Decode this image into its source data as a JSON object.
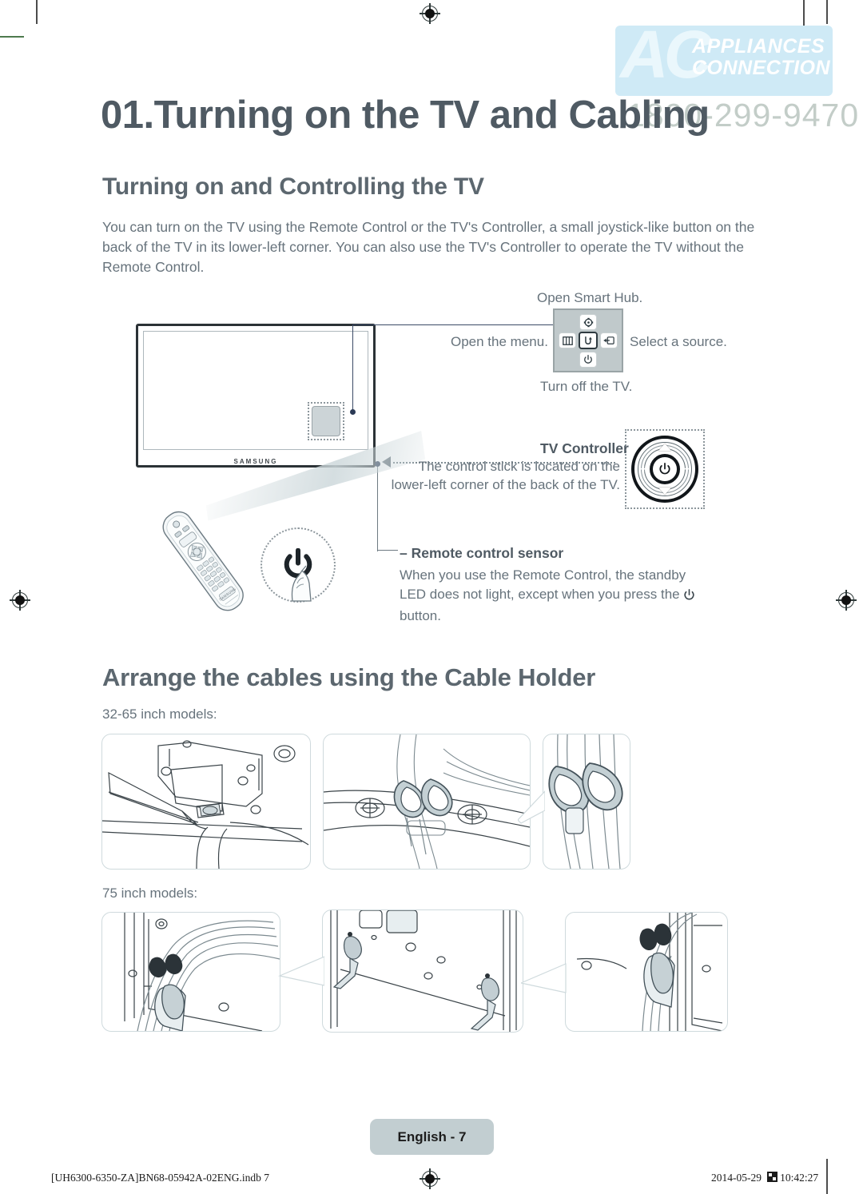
{
  "document": {
    "chapter_title": "01.Turning on the TV and Cabling",
    "page_badge": "English - 7",
    "footer_left": "[UH6300-6350-ZA]BN68-05942A-02ENG.indb   7",
    "footer_date": "2014-05-29",
    "footer_time": "10:42:27"
  },
  "watermark": {
    "logo_mark": "AC",
    "line1": "APPLIANCES",
    "line2": "CONNECTION",
    "phone": "1800-299-9470",
    "bg_color": "#cfeaf6"
  },
  "section_control": {
    "heading": "Turning on and Controlling the TV",
    "paragraph": "You can turn on the TV using the Remote Control or the TV's Controller, a small joystick-like button on the back of the TV in its lower-left corner. You can also use the TV's Controller to operate the TV without the Remote Control."
  },
  "controller_diagram": {
    "label_smart_hub": "Open Smart Hub.",
    "label_menu": "Open the menu.",
    "label_source": "Select a source.",
    "label_power": "Turn off the TV.",
    "keys": {
      "up_icon": "smart-hub-icon",
      "up_glyph": "⚙",
      "left_icon": "menu-icon",
      "left_glyph": "☰",
      "center_icon": "return-icon",
      "center_glyph": "↺",
      "right_icon": "source-icon",
      "right_glyph": "↤",
      "down_icon": "power-icon",
      "down_glyph": "⏻"
    }
  },
  "tv_illustration": {
    "brand": "SAMSUNG"
  },
  "tv_controller": {
    "title": "TV Controller",
    "description": "The control stick is located on the lower-left corner of the back of the TV.",
    "joystick": {
      "center_glyph": "⏻",
      "plus": "+",
      "minus": "−"
    }
  },
  "remote_sensor": {
    "title": "Remote control sensor",
    "description_before": "When you use the Remote Control, the standby LED does not light, except when you press the ",
    "power_glyph": "⏻",
    "description_after": " button."
  },
  "section_cables": {
    "heading": "Arrange the cables using the Cable Holder",
    "label_small_models": "32-65 inch models:",
    "label_large_models": "75 inch models:"
  },
  "colors": {
    "heading_text": "#4f5a63",
    "body_text": "#67737c",
    "panel_border": "#cfdadd",
    "badge_bg": "#c2ced1",
    "line": "#3b4a66"
  }
}
